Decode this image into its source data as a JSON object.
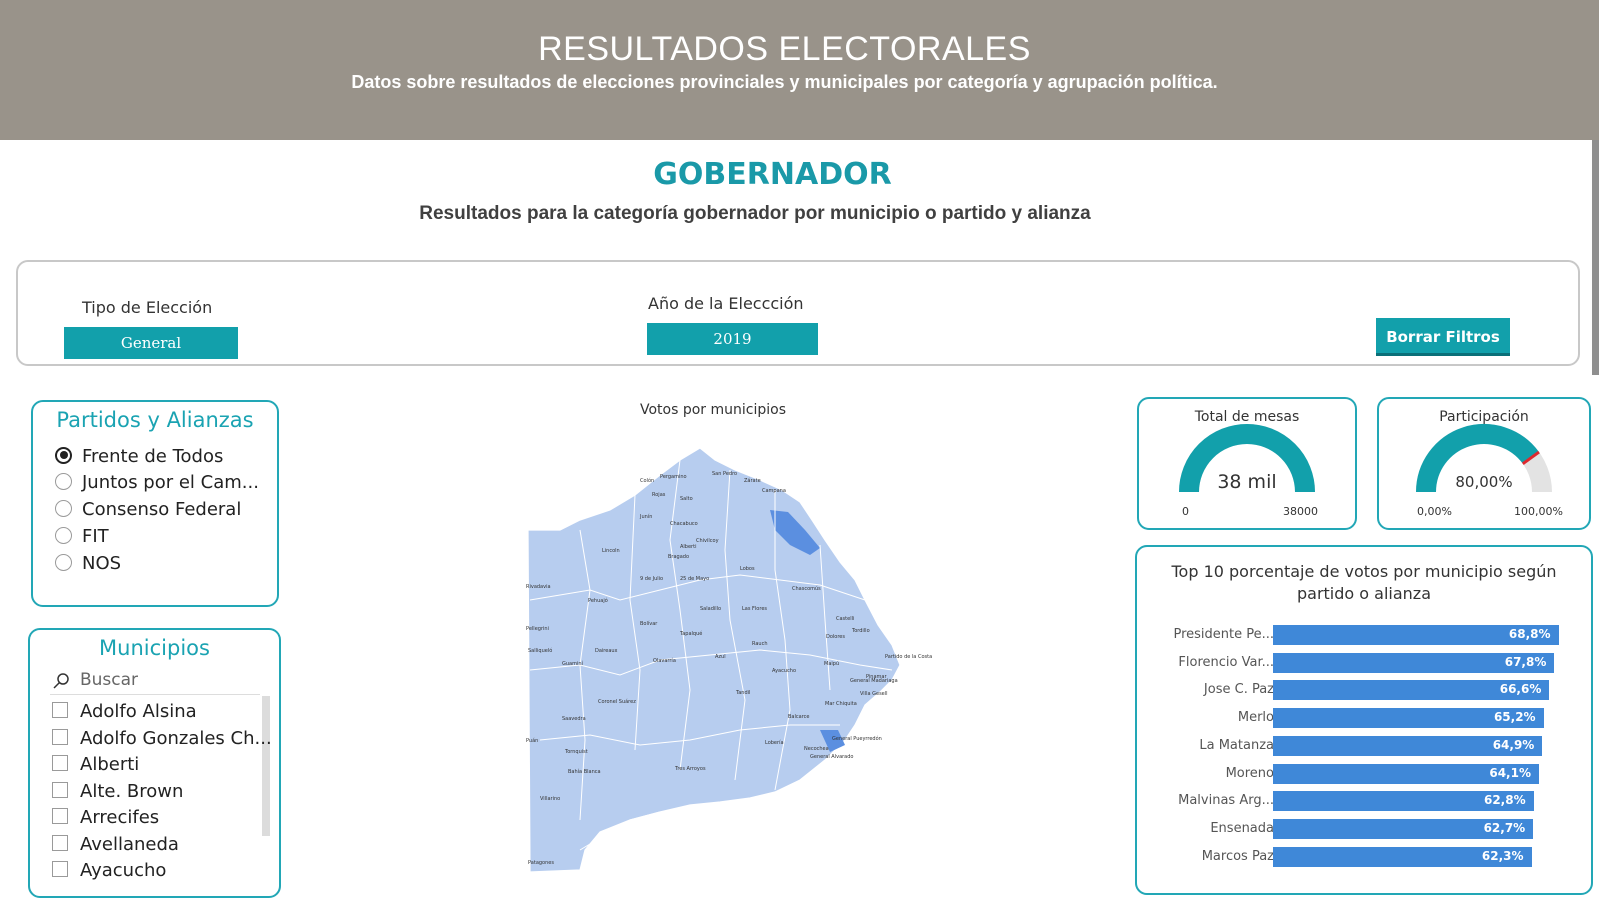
{
  "header": {
    "title": "RESULTADOS ELECTORALES",
    "subtitle": "Datos sobre resultados de elecciones provinciales y municipales por categoría y agrupación política."
  },
  "category": {
    "title": "GOBERNADOR",
    "subtitle": "Resultados para la categoría gobernador por  municipio o partido y alianza"
  },
  "filters": {
    "tipo_label": "Tipo de Elección",
    "tipo_value": "General",
    "anio_label": "Año de la Eleccción",
    "anio_value": "2019",
    "clear_label": "Borrar Filtros"
  },
  "partidos": {
    "title": "Partidos y Alianzas",
    "items": [
      {
        "label": "Frente de Todos",
        "selected": true
      },
      {
        "label": "Juntos por el Cam...",
        "selected": false
      },
      {
        "label": "Consenso Federal",
        "selected": false
      },
      {
        "label": "FIT",
        "selected": false
      },
      {
        "label": "NOS",
        "selected": false
      }
    ]
  },
  "municipios": {
    "title": "Municipios",
    "search_placeholder": "Buscar",
    "items": [
      "Adolfo Alsina",
      "Adolfo Gonzales Ch...",
      "Alberti",
      "Alte. Brown",
      "Arrecifes",
      "Avellaneda",
      "Ayacucho"
    ]
  },
  "map": {
    "title": "Votos por municipios",
    "labels": [
      "Campana",
      "San Pedro",
      "Zárate",
      "Pergamino",
      "Colón",
      "Rojas",
      "Salto",
      "Junín",
      "Chacabuco",
      "Lincoln",
      "Bragado",
      "Alberti",
      "Chivilcoy",
      "25 de Mayo",
      "9 de Julio",
      "Pehuajó",
      "Bolívar",
      "Tapalqué",
      "Azul",
      "Olavarría",
      "Rauch",
      "Ayacucho",
      "Tandil",
      "Balcarce",
      "Lobería",
      "Necochea",
      "Tres Arroyos",
      "Coronel Suárez",
      "Puán",
      "Tornquist",
      "Bahía Blanca",
      "Villarino",
      "Patagones",
      "Saavedra",
      "Guaminí",
      "Daireaux",
      "Salliqueló",
      "Rivadavia",
      "Pellegrini",
      "Dolores",
      "Maipú",
      "Castelli",
      "Tordillo",
      "Chascomús",
      "Lobos",
      "Saladillo",
      "Las Flores",
      "General Alvarado",
      "General Pueyrredón",
      "Mar Chiquita",
      "Villa Gesell",
      "Pinamar",
      "General Madariaga",
      "Partido de la Costa"
    ]
  },
  "kpi_mesas": {
    "title": "Total de mesas",
    "value_text": "38 mil",
    "min": "0",
    "max": "38000",
    "fraction": 1.0,
    "color": "#12a0ab"
  },
  "kpi_participacion": {
    "title": "Participación",
    "value_text": "80,00%",
    "min": "0,00%",
    "max": "100,00%",
    "fraction": 0.8,
    "color": "#12a0ab",
    "target_color": "#e0282e"
  },
  "chart_data": {
    "type": "bar",
    "title": "Top 10 porcentaje de votos por municipio según partido o alianza",
    "categories": [
      "Presidente Pe...",
      "Florencio Var...",
      "Jose C. Paz",
      "Merlo",
      "La Matanza",
      "Moreno",
      "Malvinas Arg...",
      "Ensenada",
      "Marcos Paz"
    ],
    "values": [
      68.8,
      67.8,
      66.6,
      65.2,
      64.9,
      64.1,
      62.8,
      62.7,
      62.3
    ],
    "value_labels": [
      "68,8%",
      "67,8%",
      "66,6%",
      "65,2%",
      "64,9%",
      "64,1%",
      "62,8%",
      "62,7%",
      "62,3%"
    ],
    "xlim": [
      0,
      80
    ],
    "bar_color": "#3f88d8"
  }
}
